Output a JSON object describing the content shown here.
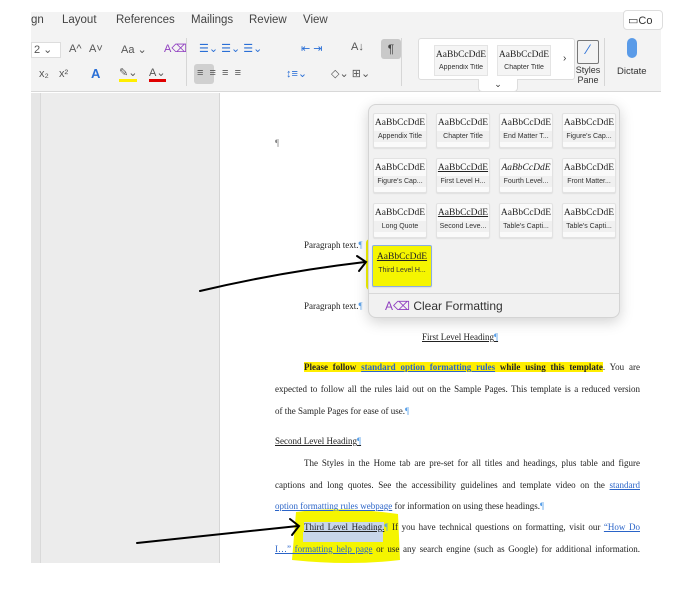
{
  "ribbon": {
    "tabs": [
      "gn",
      "Layout",
      "References",
      "Mailings",
      "Review",
      "View"
    ],
    "comments_label": "Co",
    "font_size": "2",
    "grow_font": "A^",
    "shrink_font": "A˅",
    "change_case": "Aa",
    "superscript": "x²",
    "subscript": "x₂",
    "styles_pane_label": "Styles\nPane",
    "styles_pane_line1": "Styles",
    "styles_pane_line2": "Pane",
    "dictate_label": "Dictate",
    "highlight_color": "#ffee00",
    "font_color": "#e00000",
    "gallery": [
      {
        "sample": "AaBbCcDdE",
        "label": "Appendix Title"
      },
      {
        "sample": "AaBbCcDdE",
        "label": "Chapter Title"
      }
    ]
  },
  "styles_popup": {
    "tiles": [
      {
        "sample": "AaBbCcDdE",
        "label": "Appendix Title"
      },
      {
        "sample": "AaBbCcDdE",
        "label": "Chapter Title"
      },
      {
        "sample": "AaBbCcDdE",
        "label": "End Matter T..."
      },
      {
        "sample": "AaBbCcDdE",
        "label": "Figure's Cap..."
      },
      {
        "sample": "AaBbCcDdE",
        "label": "Figure's Cap..."
      },
      {
        "sample": "AaBbCcDdE",
        "label": "First Level H..."
      },
      {
        "sample": "AaBbCcDdE",
        "label": "Fourth Level..."
      },
      {
        "sample": "AaBbCcDdE",
        "label": "Front Matter..."
      },
      {
        "sample": "AaBbCcDdE",
        "label": "Long Quote"
      },
      {
        "sample": "AaBbCcDdE",
        "label": "Second Leve..."
      },
      {
        "sample": "AaBbCcDdE",
        "label": "Table's Capti..."
      },
      {
        "sample": "AaBbCcDdE",
        "label": "Table's Capti..."
      },
      {
        "sample": "AaBbCcDdE",
        "label": "Third Level H..."
      }
    ],
    "clear_formatting": "Clear Formatting"
  },
  "document": {
    "pilcrow": "¶",
    "para1": "Paragraph text.",
    "para2": "Paragraph text.",
    "first_heading": "First Level Heading",
    "p1_bold1": "Please follow ",
    "p1_link": "standard option formatting rules",
    "p1_bold2": " while using this template",
    "p1_rest": ". You are",
    "p1_line2": "expected to follow all the rules laid out on the Sample Pages. This template is a reduced version",
    "p1_line3": "of the Sample Pages for ease of use.",
    "second_heading": "Second Level Heading",
    "p2_line1": "The Styles in the Home tab are pre-set for all titles and headings, plus table and figure",
    "p2_line2a": "captions and long quotes. See the accessibility guidelines and template video on the ",
    "p2_line2_link": "standard",
    "p2_line3_link": "option formatting rules webpage",
    "p2_line3_rest": " for information on using these headings.",
    "third_heading": "Third Level Heading.",
    "p3_rest": " If you have technical questions on formatting, visit our ",
    "p3_link1": "“How Do",
    "p3_link2": "I…” formatting help page",
    "p3_line2_rest": " or use any search engine (such as Google) for additional information."
  }
}
